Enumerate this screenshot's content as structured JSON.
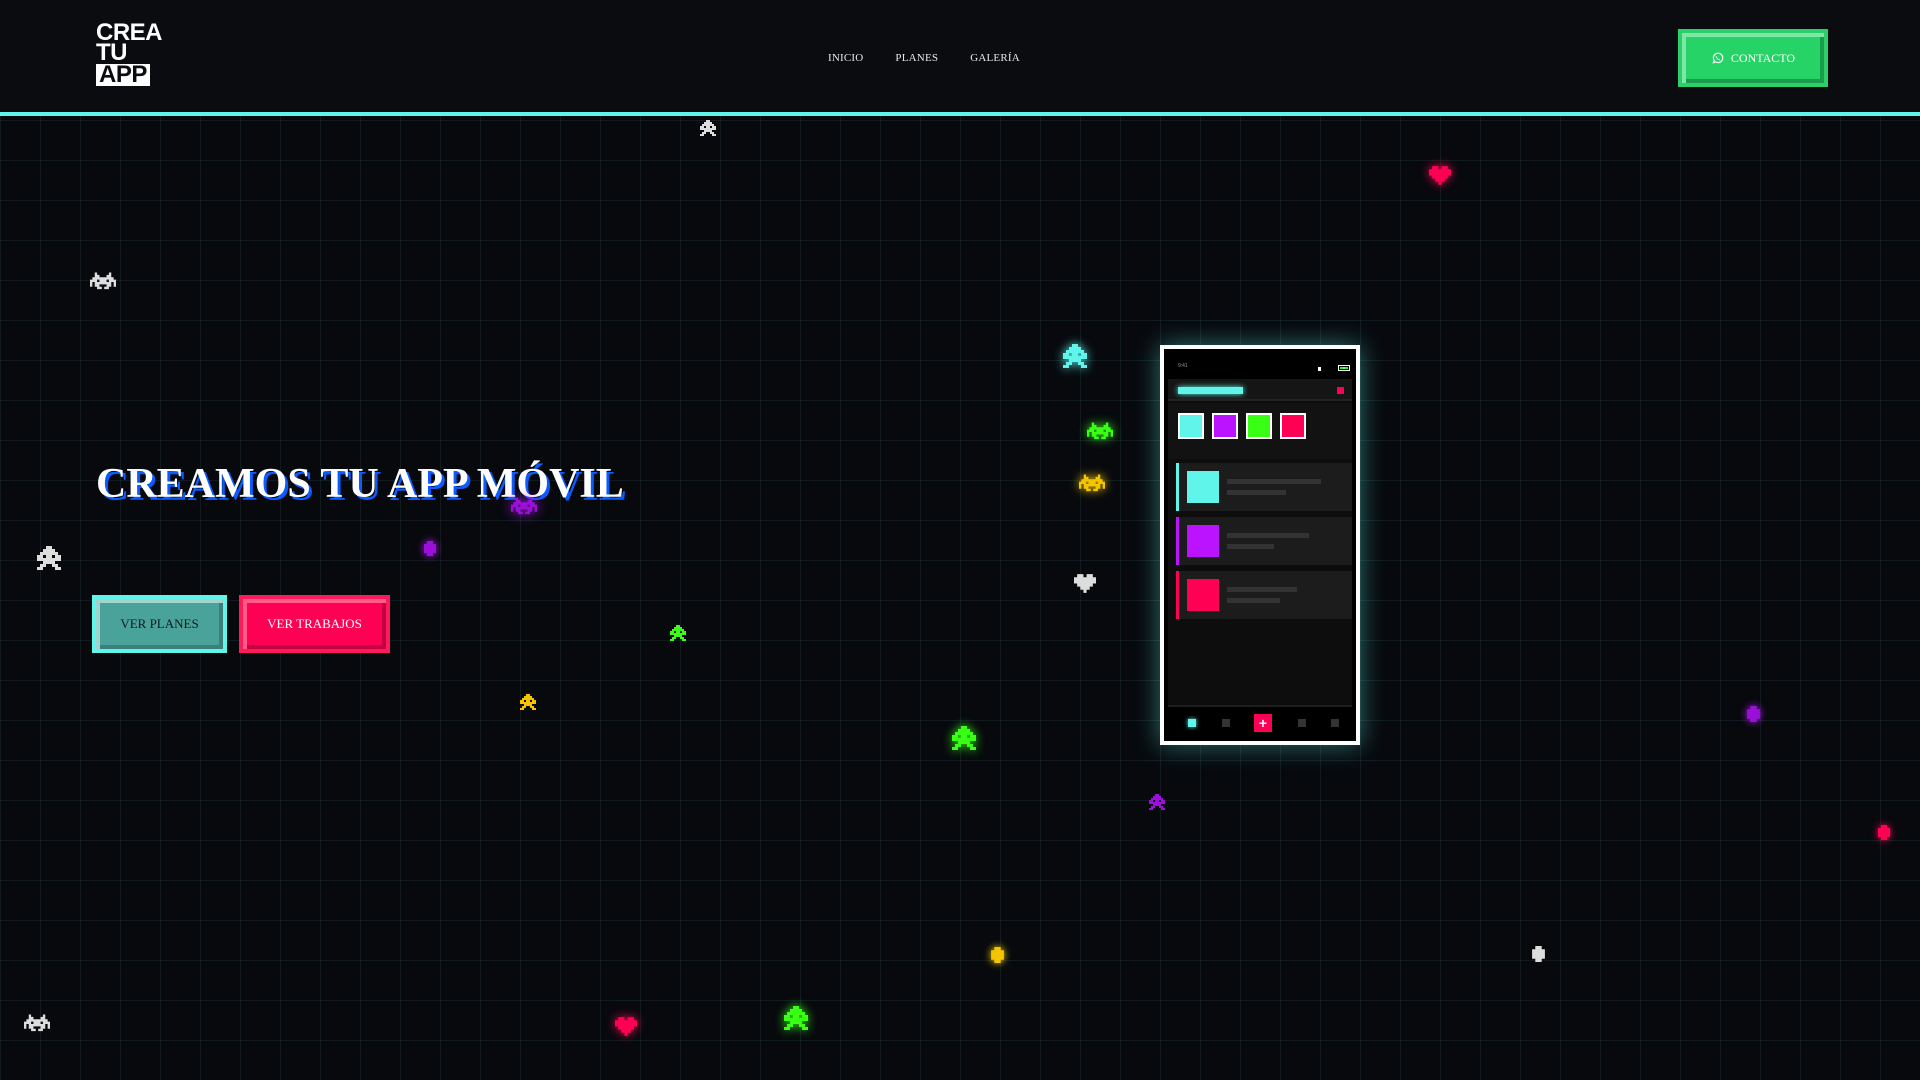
{
  "header": {
    "logo": {
      "line1": "CREA",
      "line2": "TU",
      "line3": "APP"
    },
    "nav": [
      {
        "label": "INICIO"
      },
      {
        "label": "PLANES"
      },
      {
        "label": "GALERÍA"
      }
    ],
    "contact_label": "CONTACTO"
  },
  "hero": {
    "title": "CREAMOS TU APP MÓVIL",
    "primary_button": "VER PLANES",
    "secondary_button": "VER TRABAJOS"
  },
  "phone": {
    "time": "9:41"
  },
  "colors": {
    "cyan": "#5ff5ea",
    "purple": "#bb12ff",
    "green": "#39ff14",
    "pink": "#ff0055",
    "whatsapp": "#25d366",
    "shadow_blue": "#0a5cff"
  }
}
